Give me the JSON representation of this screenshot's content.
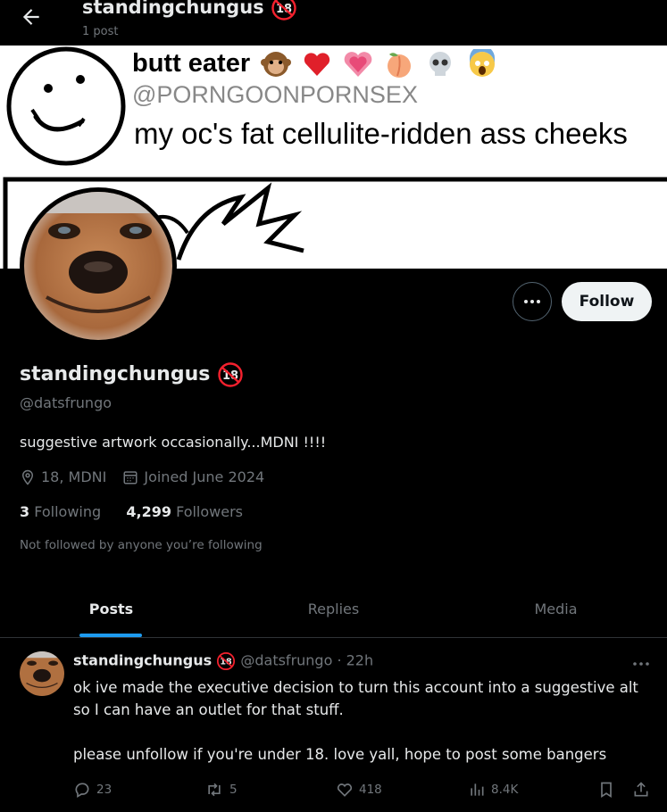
{
  "topbar": {
    "name": "standingchungus",
    "posts_count": "1 post"
  },
  "banner": {
    "line1": "butt eater",
    "line2": "@PORNGOONPORNSEX",
    "line3": "my oc's fat cellulite-ridden ass cheeks",
    "emojis": [
      "monkey-emoji",
      "heart-emoji",
      "growing-heart-emoji",
      "peach-emoji",
      "skull-emoji",
      "screaming-face-emoji"
    ]
  },
  "profile": {
    "name": "standingchungus",
    "handle": "@datsfrungo",
    "bio": "suggestive artwork occasionally...MDNI !!!!",
    "location": "18, MDNI",
    "joined": "Joined June 2024",
    "following_count": "3",
    "following_label": "Following",
    "followers_count": "4,299",
    "followers_label": "Followers",
    "not_followed": "Not followed by anyone you’re following"
  },
  "actions": {
    "follow_label": "Follow"
  },
  "tabs": [
    {
      "label": "Posts"
    },
    {
      "label": "Replies"
    },
    {
      "label": "Media"
    }
  ],
  "tweet": {
    "name": "standingchungus",
    "handle_time": "@datsfrungo · 22h",
    "text1": "ok ive made the executive decision to turn this account into a suggestive alt so I can have an outlet for that stuff.",
    "text2": "please unfollow if you're under 18. love yall, hope to post some bangers",
    "replies": "23",
    "reposts": "5",
    "likes": "418",
    "views": "8.4K"
  },
  "colors": {
    "accent": "#1d9bf0",
    "badge_red": "#f4212e",
    "muted": "#71767b"
  }
}
